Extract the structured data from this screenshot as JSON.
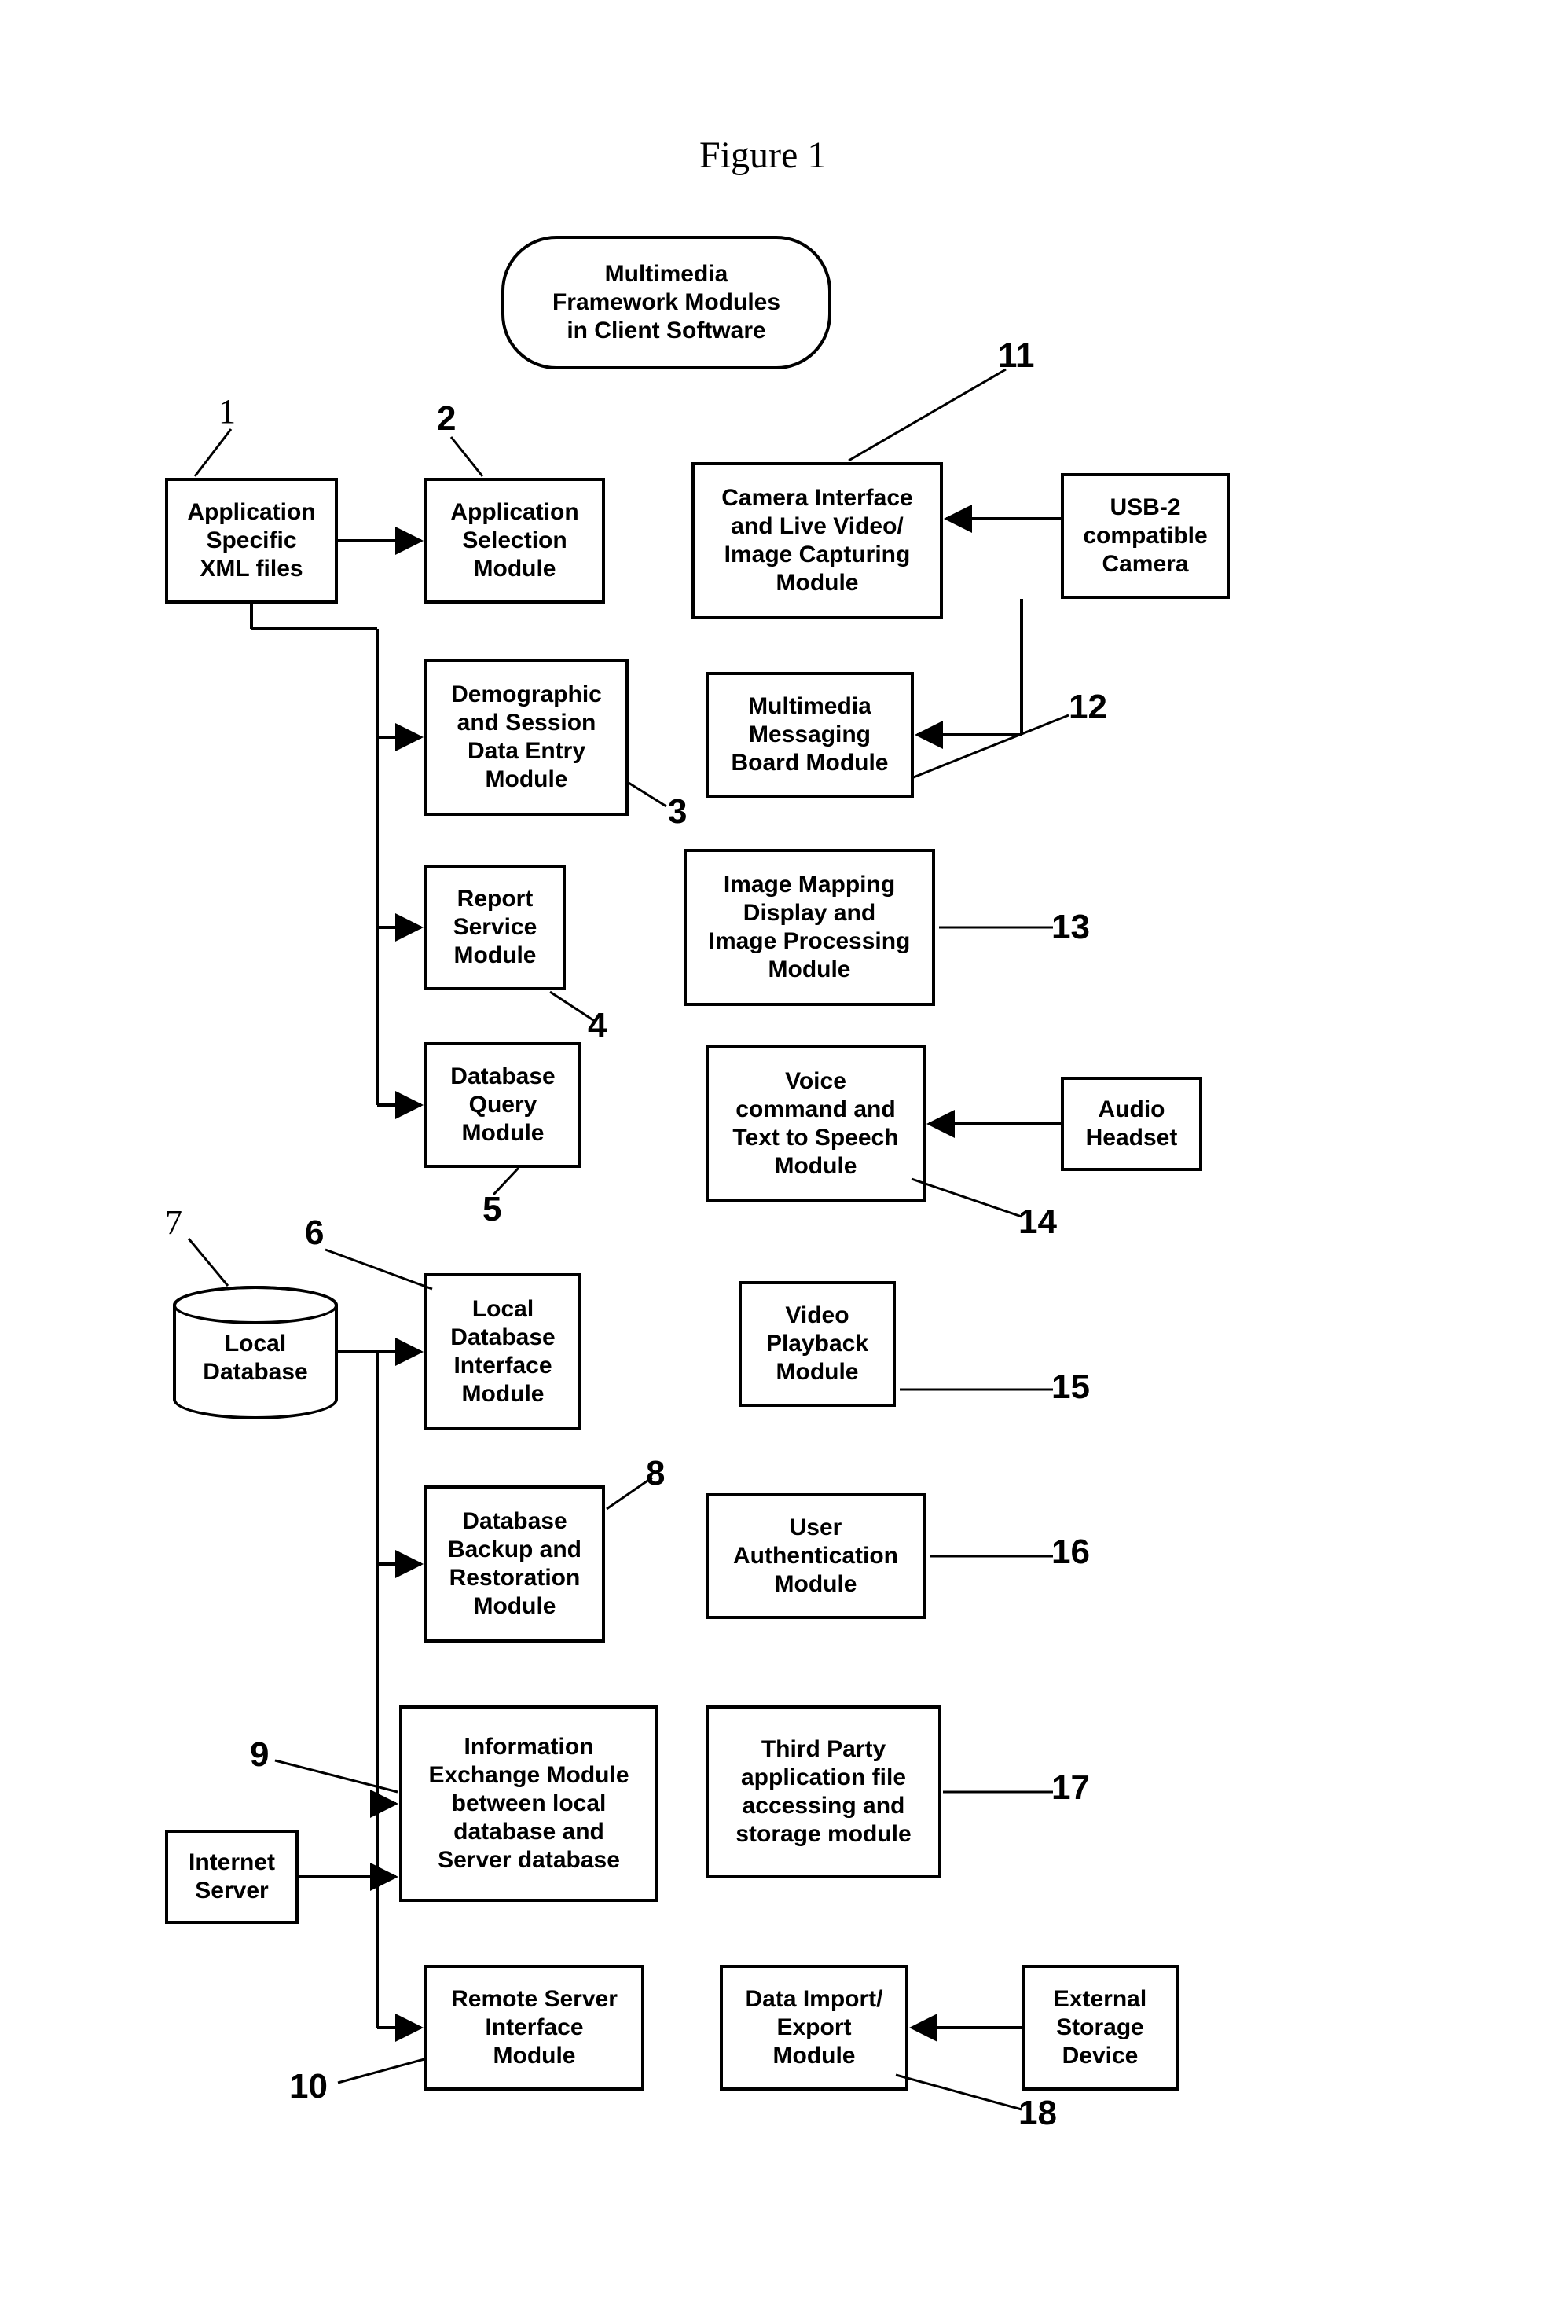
{
  "title": "Figure 1",
  "header_pill": "Multimedia\nFramework Modules\nin Client Software",
  "boxes": {
    "b1": "Application\nSpecific\nXML files",
    "b2": "Application\nSelection\nModule",
    "b3": "Demographic\nand Session\nData Entry\nModule",
    "b4": "Report\nService\nModule",
    "b5": "Database\nQuery\nModule",
    "b6": "Local\nDatabase\nInterface\nModule",
    "b7": "Local\nDatabase",
    "b8": "Database\nBackup and\nRestoration\nModule",
    "b9": "Information\nExchange Module\nbetween local\ndatabase and\nServer database",
    "b10": "Remote Server\nInterface\nModule",
    "b11": "Camera Interface\nand Live Video/\nImage Capturing\nModule",
    "b12": "Multimedia\nMessaging\nBoard Module",
    "b13": "Image Mapping\nDisplay and\nImage Processing\nModule",
    "b14": "Voice\ncommand and\nText to Speech\nModule",
    "b15": "Video\nPlayback\nModule",
    "b16": "User\nAuthentication\nModule",
    "b17": "Third Party\napplication file\naccessing and\nstorage module",
    "b18": "Data Import/\nExport\nModule",
    "usb": "USB-2\ncompatible\nCamera",
    "headset": "Audio\nHeadset",
    "internet": "Internet\nServer",
    "extstorage": "External\nStorage\nDevice"
  },
  "refs": {
    "r1": "1",
    "r2": "2",
    "r3": "3",
    "r4": "4",
    "r5": "5",
    "r6": "6",
    "r7": "7",
    "r8": "8",
    "r9": "9",
    "r10": "10",
    "r11": "11",
    "r12": "12",
    "r13": "13",
    "r14": "14",
    "r15": "15",
    "r16": "16",
    "r17": "17",
    "r18": "18"
  }
}
